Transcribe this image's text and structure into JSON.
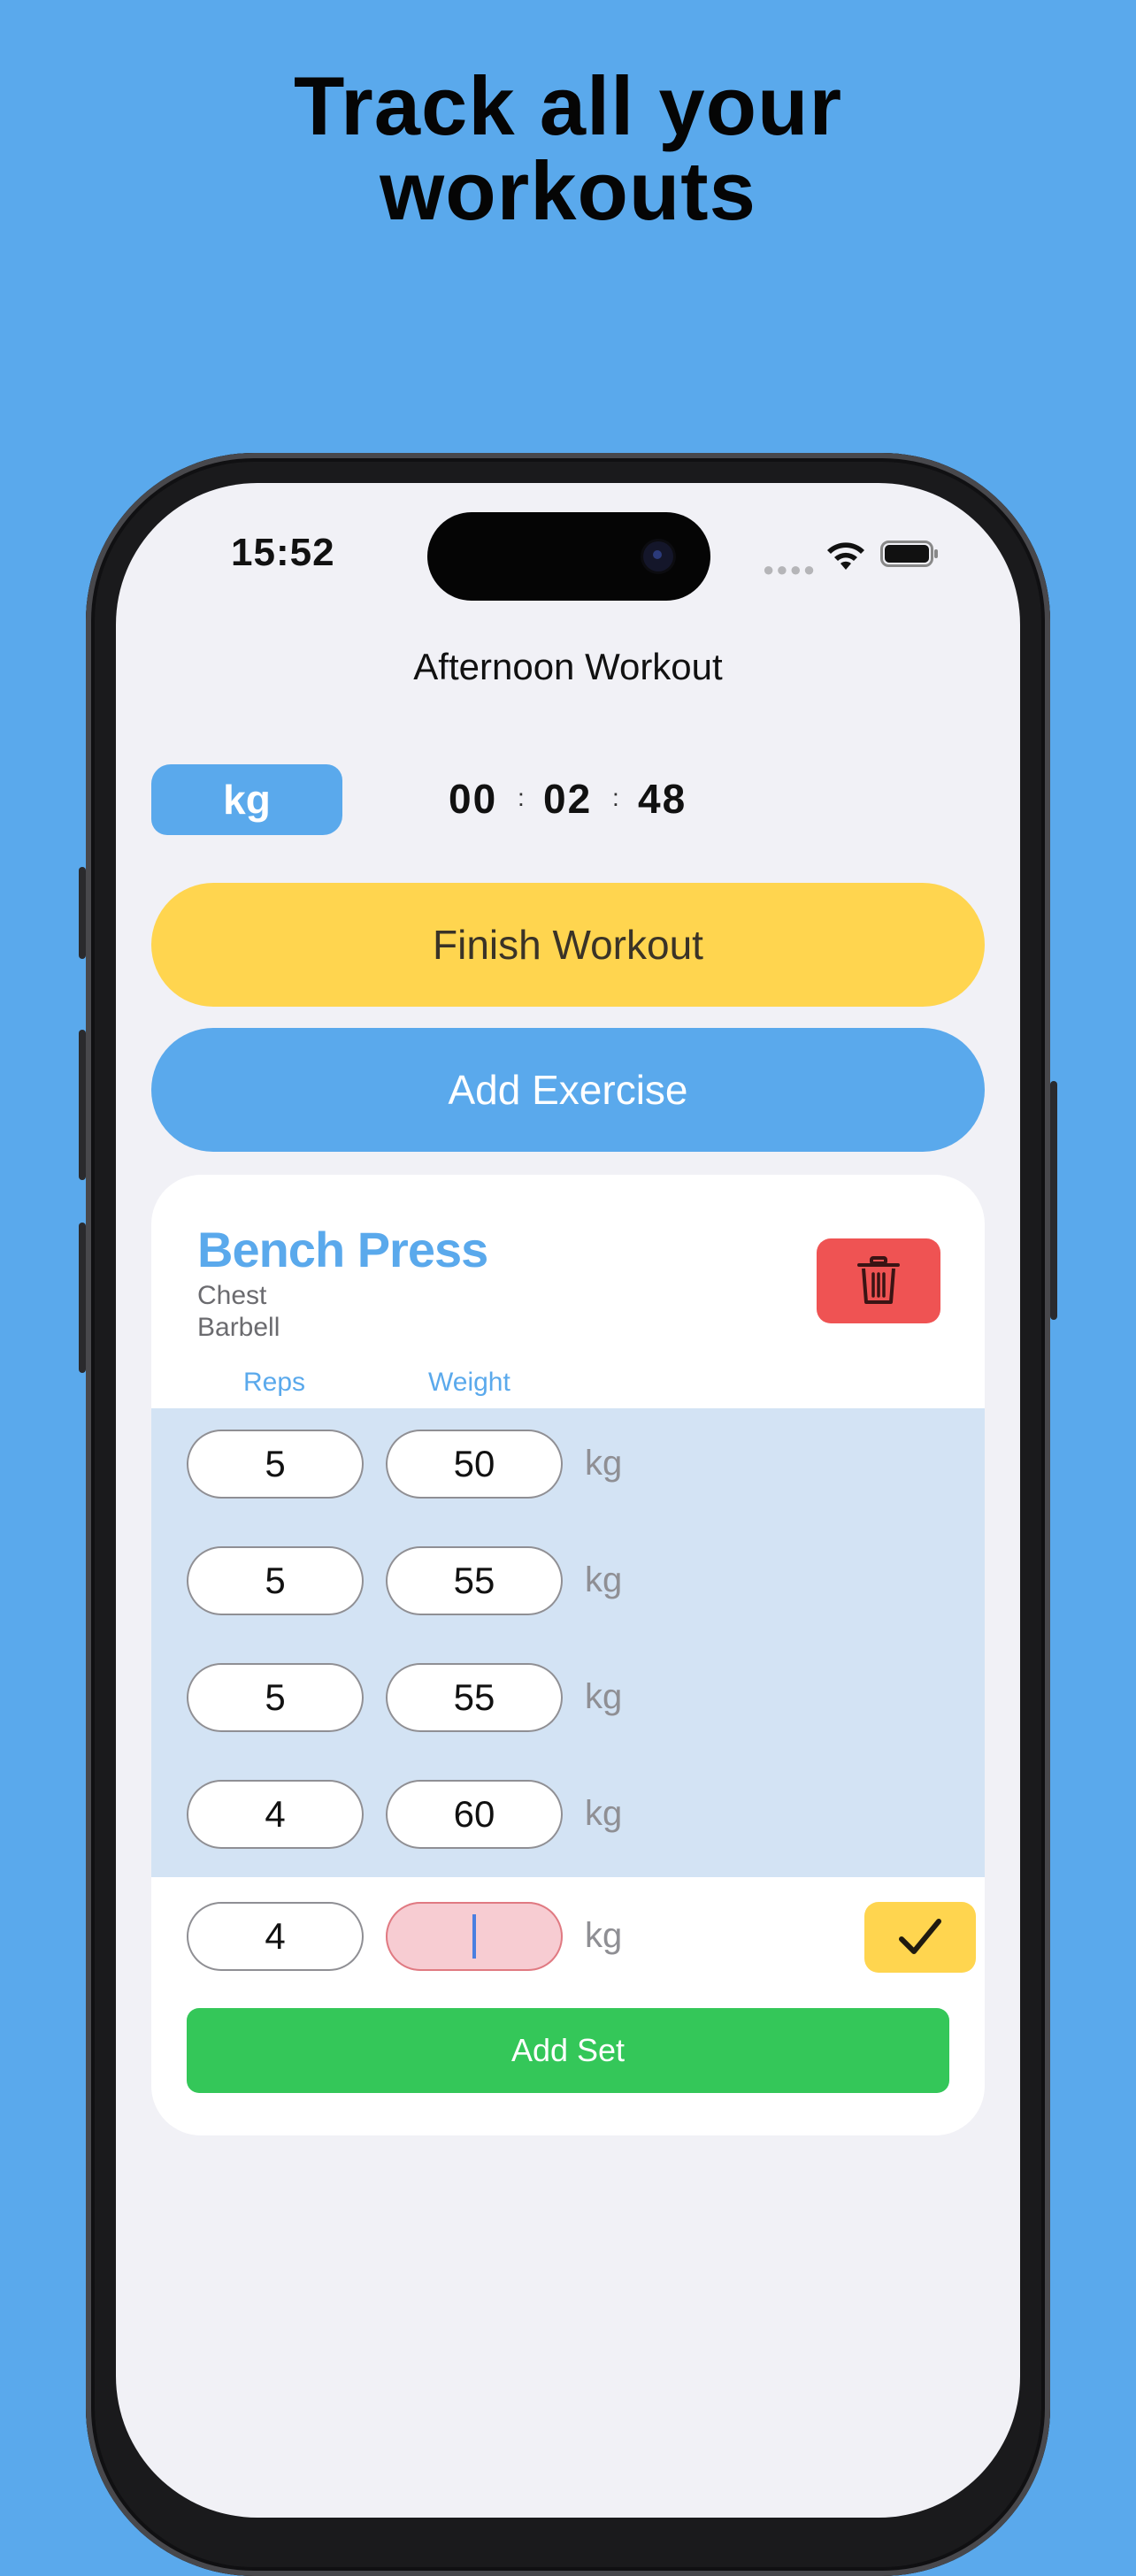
{
  "headline": {
    "line1": "Track all your",
    "line2": "workouts"
  },
  "status_bar": {
    "time": "15:52"
  },
  "workout": {
    "title": "Afternoon Workout",
    "unit_toggle": "kg",
    "timer": {
      "hours": "00",
      "minutes": "02",
      "seconds": "48",
      "separator": ":"
    },
    "finish_label": "Finish Workout",
    "add_exercise_label": "Add Exercise"
  },
  "exercise": {
    "name": "Bench Press",
    "muscle": "Chest",
    "equipment": "Barbell",
    "columns": {
      "reps": "Reps",
      "weight": "Weight"
    },
    "unit": "kg",
    "sets": [
      {
        "reps": "5",
        "weight": "50"
      },
      {
        "reps": "5",
        "weight": "55"
      },
      {
        "reps": "5",
        "weight": "55"
      },
      {
        "reps": "4",
        "weight": "60"
      }
    ],
    "current_set": {
      "reps": "4",
      "weight": ""
    },
    "add_set_label": "Add Set"
  },
  "colors": {
    "background": "#5AA9EC",
    "accent_blue": "#5AA9EC",
    "finish_yellow": "#FFD54F",
    "delete_red": "#EF5353",
    "add_set_green": "#34C759",
    "completed_row_band": "#D3E3F4"
  },
  "icons": {
    "trash": "trash-icon",
    "check": "checkmark-icon",
    "wifi": "wifi-icon",
    "battery": "battery-icon",
    "cellular": "cellular-dots-icon"
  }
}
